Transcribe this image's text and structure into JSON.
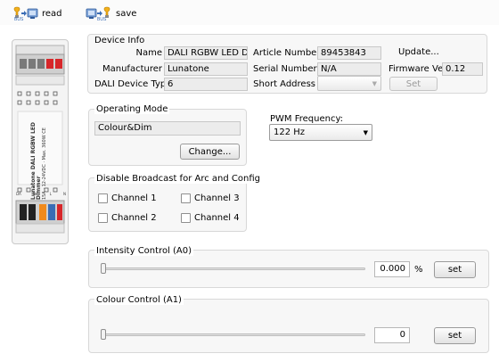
{
  "toolbar": {
    "read_label": "read",
    "save_label": "save"
  },
  "device_info": {
    "title": "Device Info",
    "name_label": "Name",
    "name_value": "DALI RGBW LED Di...",
    "manufacturer_label": "Manufacturer",
    "manufacturer_value": "Lunatone",
    "device_type_label": "DALI Device Type",
    "device_type_value": "6",
    "article_label": "Article Number",
    "article_value": "89453843",
    "serial_label": "Serial Number",
    "serial_value": "N/A",
    "short_address_label": "Short Address",
    "short_address_value": "",
    "update_label": "Update...",
    "firmware_label": "Firmware Ver",
    "firmware_value": "0.12",
    "set_label": "Set"
  },
  "operating_mode": {
    "title": "Operating Mode",
    "value": "Colour&Dim",
    "change_label": "Change..."
  },
  "pwm": {
    "label": "PWM Frequency:",
    "selected": "122 Hz"
  },
  "broadcast": {
    "title": "Disable Broadcast  for Arc and Config",
    "channels": [
      "Channel 1",
      "Channel 3",
      "Channel 2",
      "Channel 4"
    ]
  },
  "intensity": {
    "title": "Intensity Control (A0)",
    "value": "0.000",
    "unit": "%",
    "set_label": "set",
    "level": 0
  },
  "colour": {
    "title": "Colour Control (A1)",
    "value": "0",
    "set_label": "set",
    "level": 0
  },
  "device_text": {
    "brand": "Lunatone",
    "model": "DALI RGBW LED Dimmer",
    "spec_current": "15A",
    "spec_voltage": "12-24VDC",
    "spec_power": "Max. 360W",
    "spec_ce": "CE",
    "pin_labels": [
      "DA",
      "DA",
      "L",
      "N"
    ]
  },
  "colors": {
    "accent_red": "#d7262a",
    "accent_orange": "#f08a1c",
    "accent_blue": "#3a6db5"
  }
}
